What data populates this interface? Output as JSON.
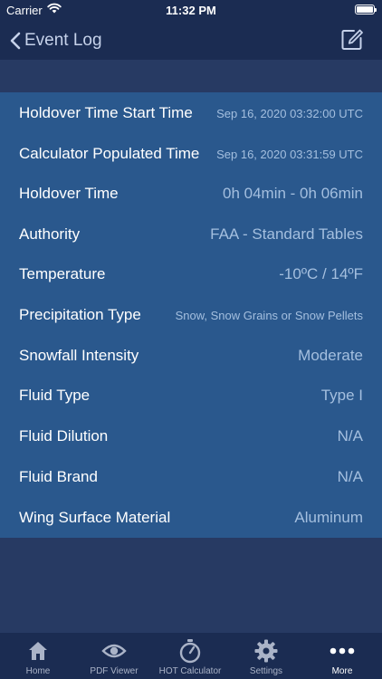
{
  "status_bar": {
    "carrier": "Carrier",
    "time": "11:32 PM"
  },
  "nav": {
    "back_label": "Event Log"
  },
  "rows": [
    {
      "label": "Holdover Time Start Time",
      "value": "Sep 16, 2020 03:32:00 UTC"
    },
    {
      "label": "Calculator Populated Time",
      "value": "Sep 16, 2020 03:31:59 UTC"
    },
    {
      "label": "Holdover Time",
      "value": "0h 04min - 0h 06min"
    },
    {
      "label": "Authority",
      "value": "FAA - Standard Tables"
    },
    {
      "label": "Temperature",
      "value": "-10ºC / 14ºF"
    },
    {
      "label": "Precipitation Type",
      "value": "Snow, Snow Grains or Snow Pellets"
    },
    {
      "label": "Snowfall Intensity",
      "value": "Moderate"
    },
    {
      "label": "Fluid Type",
      "value": "Type I"
    },
    {
      "label": "Fluid Dilution",
      "value": "N/A"
    },
    {
      "label": "Fluid Brand",
      "value": "N/A"
    },
    {
      "label": "Wing Surface Material",
      "value": "Aluminum"
    }
  ],
  "tabs": [
    {
      "label": "Home",
      "icon": "home-icon"
    },
    {
      "label": "PDF Viewer",
      "icon": "eye-icon"
    },
    {
      "label": "HOT Calculator",
      "icon": "stopwatch-icon"
    },
    {
      "label": "Settings",
      "icon": "gear-icon"
    },
    {
      "label": "More",
      "icon": "more-icon",
      "active": true
    }
  ],
  "colors": {
    "nav_background": "#1b2c52",
    "page_background": "#273a63",
    "list_background": "#2a588d",
    "value_text": "#a4bfdf"
  }
}
